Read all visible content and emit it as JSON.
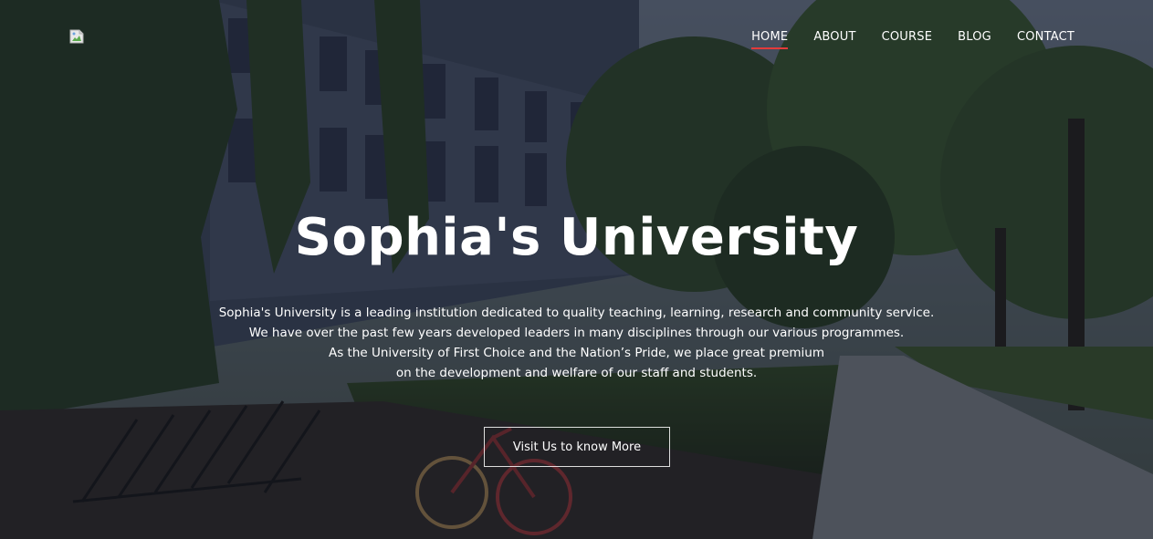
{
  "logo": {
    "icon": "broken-image-icon"
  },
  "nav": {
    "items": [
      {
        "label": "HOME",
        "active": true
      },
      {
        "label": "ABOUT",
        "active": false
      },
      {
        "label": "COURSE",
        "active": false
      },
      {
        "label": "BLOG",
        "active": false
      },
      {
        "label": "CONTACT",
        "active": false
      }
    ],
    "active_underline_color": "#e33b3b"
  },
  "hero": {
    "title": "Sophia's University",
    "description_lines": [
      "Sophia's University is a leading institution dedicated to quality teaching, learning, research and community service.",
      "We have over the past few years developed leaders in many disciplines through our various programmes.",
      "As the University of First Choice and the Nation’s Pride, we place great premium",
      "on the development and welfare of our staff and students."
    ],
    "cta_label": "Visit Us to know More"
  }
}
